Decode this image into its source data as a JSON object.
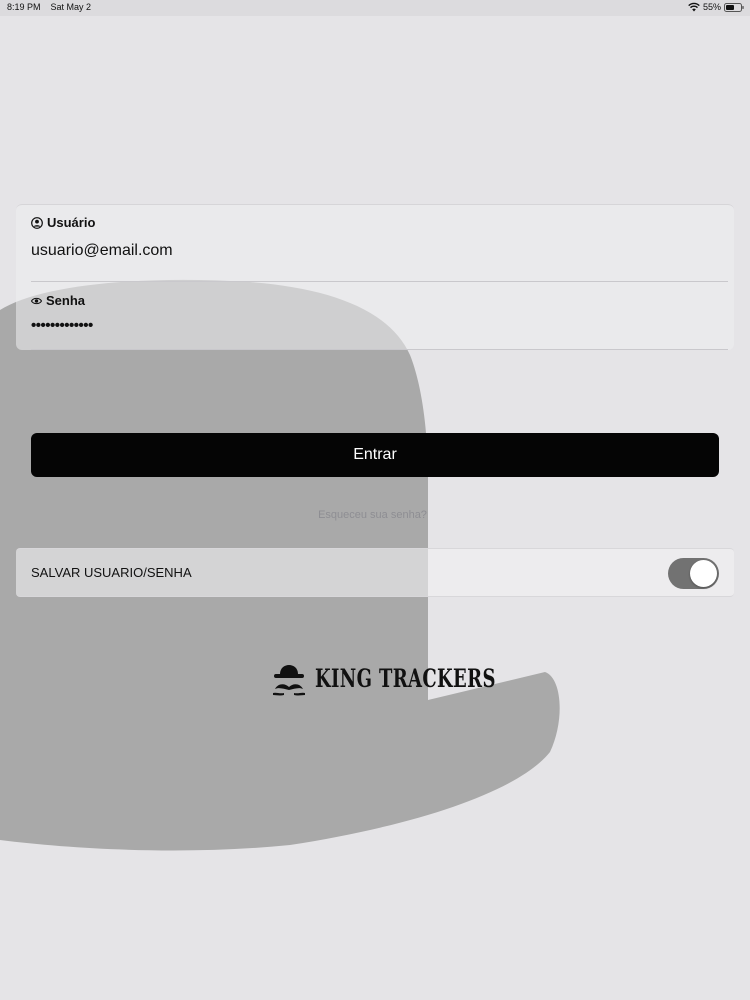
{
  "status_bar": {
    "time": "8:19 PM",
    "date": "Sat May 2",
    "battery": "55%",
    "wifi_icon": "wifi-icon",
    "battery_icon": "battery-icon"
  },
  "form": {
    "username": {
      "label": "Usuário",
      "icon": "user-circle-icon",
      "value": "usuario@email.com"
    },
    "password": {
      "label": "Senha",
      "icon": "eye-icon",
      "value": "•••••••••••••"
    }
  },
  "login_button": {
    "label": "Entrar",
    "color": "#050505"
  },
  "forgot_password": {
    "label": "Esqueceu sua senha?"
  },
  "save_credentials": {
    "label": "SALVAR USUARIO/SENHA",
    "toggle_on": true
  },
  "brand": {
    "name": "KING TRACKERS",
    "icon": "bowler-hat-mustache-icon"
  }
}
